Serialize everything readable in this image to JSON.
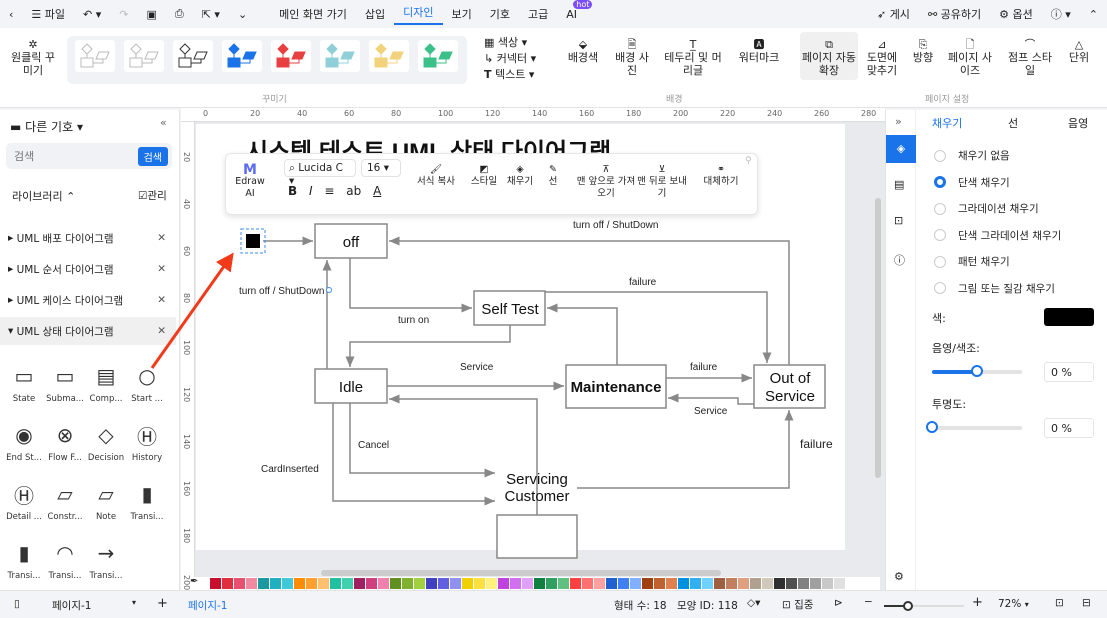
{
  "menubar": {
    "file": "파일",
    "items": [
      "메인 화면 가기",
      "삽입",
      "디자인",
      "보기",
      "기호",
      "고급",
      "AI"
    ],
    "active": "디자인",
    "hot_badge": "hot",
    "right": {
      "publish": "게시",
      "share": "공유하기",
      "options": "옵션"
    }
  },
  "ribbon": {
    "one_click": "원클릭 꾸미기",
    "decorate_group": "꾸미기",
    "color": "색상",
    "connector": "커넥터",
    "text": "텍스트",
    "bg_color": "배경색",
    "bg_image": "배경 사진",
    "border_header": "테두리 및 머리글",
    "watermark": "워터마크",
    "bg_group": "배경",
    "auto_expand": "페이지 자동 확장",
    "fit_drawing": "도면에 맞추기",
    "orientation": "방향",
    "page_size": "페이지 사이즈",
    "jump_style": "점프 스타일",
    "unit": "단위",
    "page_setup_group": "페이지 설정",
    "theme_colors": [
      "#bbbbbb",
      "#bbbbbb",
      "#333333",
      "#1a73e8",
      "#e84040",
      "#8fd0d8",
      "#f2d27a",
      "#3cc08a"
    ]
  },
  "left": {
    "title": "다른 기호",
    "search_placeholder": "검색",
    "search_btn": "검색",
    "library": "라이브러리",
    "manage": "관리",
    "libs": [
      "UML 배포 다이어그램",
      "UML 순서 다이어그램",
      "UML 케이스 다이어그램",
      "UML 상태 다이어그램"
    ],
    "symbols": [
      "State",
      "Subma...",
      "Comp...",
      "Start ...",
      "End St...",
      "Flow F...",
      "Decision",
      "History",
      "Detail ...",
      "Constr...",
      "Note",
      "Transi...",
      "Transi...",
      "Transi...",
      "Transi..."
    ]
  },
  "ruler": {
    "top": [
      "0",
      "20",
      "40",
      "60",
      "80",
      "100",
      "120",
      "140",
      "160",
      "180",
      "200",
      "220",
      "240",
      "260",
      "280"
    ],
    "left": [
      "20",
      "40",
      "60",
      "80",
      "100",
      "120",
      "140",
      "160",
      "180",
      "200"
    ]
  },
  "canvas": {
    "title": "시스템 테스트 UML 상태 다이어그램",
    "states": {
      "off": "off",
      "self_test": "Self Test",
      "idle": "Idle",
      "maintenance": "Maintenance",
      "oos1": "Out of",
      "oos2": "Service",
      "sc1": "Servicing",
      "sc2": "Customer"
    },
    "labels": {
      "shutdown_top": "turn off / ShutDown",
      "shutdown_left": "turn off / ShutDown",
      "turn_on": "turn on",
      "failure1": "failure",
      "service1": "Service",
      "failure2": "failure",
      "service2": "Service",
      "cancel": "Cancel",
      "card": "CardInserted",
      "failure3": "failure"
    }
  },
  "floatbar": {
    "ai": "Edraw AI",
    "font": "Lucida C",
    "size": "16",
    "format_copy": "서식 복사",
    "style": "스타일",
    "fill": "채우기",
    "line": "선",
    "front": "맨 앞으로 가져오기",
    "back": "맨 뒤로 보내기",
    "replace": "대체하기"
  },
  "right": {
    "tabs": [
      "채우기",
      "선",
      "음영"
    ],
    "options": [
      "채우기 없음",
      "단색 채우기",
      "그라데이션 채우기",
      "단색 그라데이션 채우기",
      "패턴 채우기",
      "그림 또는 질감 채우기"
    ],
    "selected": 1,
    "color_label": "색:",
    "color": "#000000",
    "shade_label": "음영/색조:",
    "shade_value": "0 %",
    "shade_level": 0.5,
    "opacity_label": "투명도:",
    "opacity_value": "0 %",
    "opacity_level": 0
  },
  "palette": [
    "#c8102e",
    "#e03040",
    "#e85070",
    "#f08aa0",
    "#1a9aa0",
    "#20b0c0",
    "#40c8d8",
    "#ff8c00",
    "#ffa030",
    "#ffc070",
    "#20c0a0",
    "#40d0b0",
    "#a02060",
    "#d04080",
    "#f080b0",
    "#609020",
    "#80b030",
    "#a0d040",
    "#4040c0",
    "#6060e0",
    "#9090f0",
    "#f0d000",
    "#ffe040",
    "#fff080",
    "#c040e0",
    "#d070f0",
    "#e0a0f8",
    "#108040",
    "#30a060",
    "#60c080",
    "#ff4040",
    "#ff7070",
    "#ffa0a0",
    "#2060d0",
    "#4080f0",
    "#80b0ff",
    "#a04010",
    "#c06030",
    "#e08050",
    "#0090e0",
    "#30b0f0",
    "#70d0ff",
    "#a06040",
    "#c08060",
    "#e0a080",
    "#b0a090",
    "#d0c8b8",
    "#303030",
    "#505050",
    "#808080",
    "#a0a0a0",
    "#c8c8c8",
    "#e0e0e0"
  ],
  "status": {
    "page_select": "페이지-1",
    "page_tab": "페이지-1",
    "shape_count": "형태 수: 18",
    "shape_id": "모양 ID: 118",
    "focus": "집중",
    "zoom": "72%",
    "zoom_level": 0.3
  }
}
